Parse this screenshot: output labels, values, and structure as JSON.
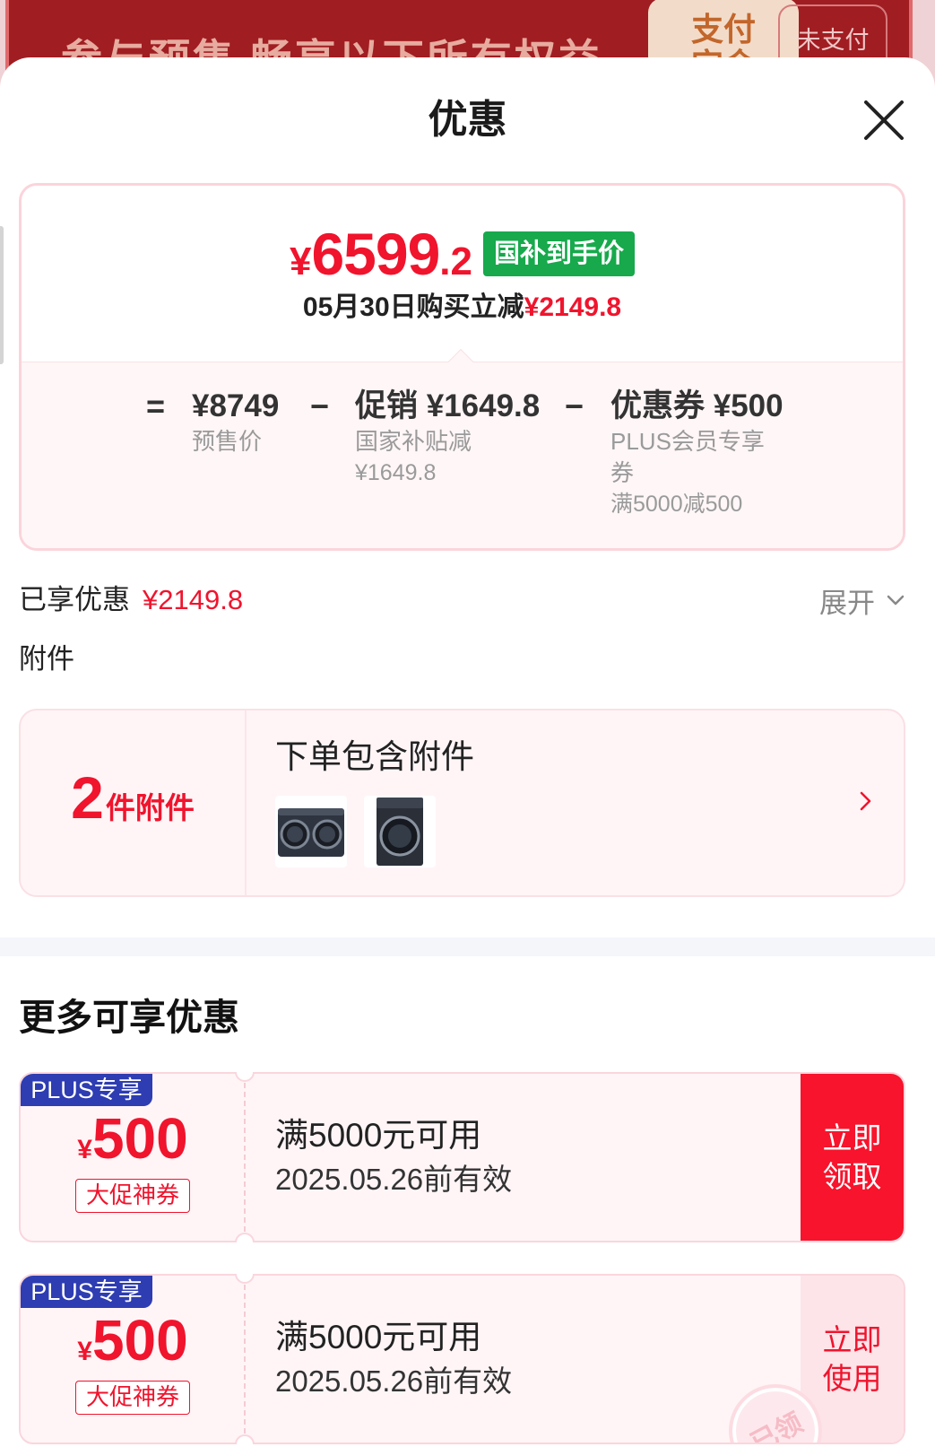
{
  "background_banner": {
    "title": "参与预售 畅享以下所有权益",
    "deposit_label": "支付定金",
    "deposit_status": "未支付"
  },
  "sheet": {
    "title": "优惠",
    "close_icon": "close-icon"
  },
  "price_card": {
    "currency": "¥",
    "price_integer": "6599",
    "price_decimal": ".2",
    "badge": "国补到手价",
    "summary_prefix": "05月30日购买立减",
    "summary_amount": "¥2149.8",
    "breakdown": {
      "equals": "=",
      "minus": "−",
      "items": [
        {
          "value": "¥8749",
          "label": "预售价"
        },
        {
          "value": "促销 ¥1649.8",
          "label": "国家补贴减",
          "detail": "¥1649.8"
        },
        {
          "value": "优惠券 ¥500",
          "label": "PLUS会员专享券",
          "detail": "满5000减500"
        }
      ]
    }
  },
  "savings": {
    "label": "已享优惠",
    "amount": "¥2149.8",
    "expand_label": "展开",
    "expand_icon": "chevron-down-icon"
  },
  "attachments": {
    "section_title": "附件",
    "count": "2",
    "count_unit": "件附件",
    "heading": "下单包含附件",
    "thumbnails": [
      {
        "icon": "twin-drum-washer-image"
      },
      {
        "icon": "front-load-washer-image"
      }
    ],
    "arrow_icon": "chevron-right-icon"
  },
  "more_offers": {
    "title": "更多可享优惠",
    "coupons": [
      {
        "tag": "PLUS专享",
        "currency": "¥",
        "amount": "500",
        "badge": "大促神券",
        "condition": "满5000元可用",
        "validity": "2025.05.26前有效",
        "action": [
          "立即",
          "领取"
        ]
      },
      {
        "tag": "PLUS专享",
        "currency": "¥",
        "amount": "500",
        "badge": "大促神券",
        "condition": "满5000元可用",
        "validity": "2025.05.26前有效",
        "action": [
          "立即",
          "使用"
        ],
        "stamp": "已领"
      }
    ]
  },
  "colors": {
    "price_red": "#f0142d",
    "badge_green": "#17a94c",
    "plus_tag_blue": "#2e3db2",
    "claim_button_red": "#f7142c"
  }
}
